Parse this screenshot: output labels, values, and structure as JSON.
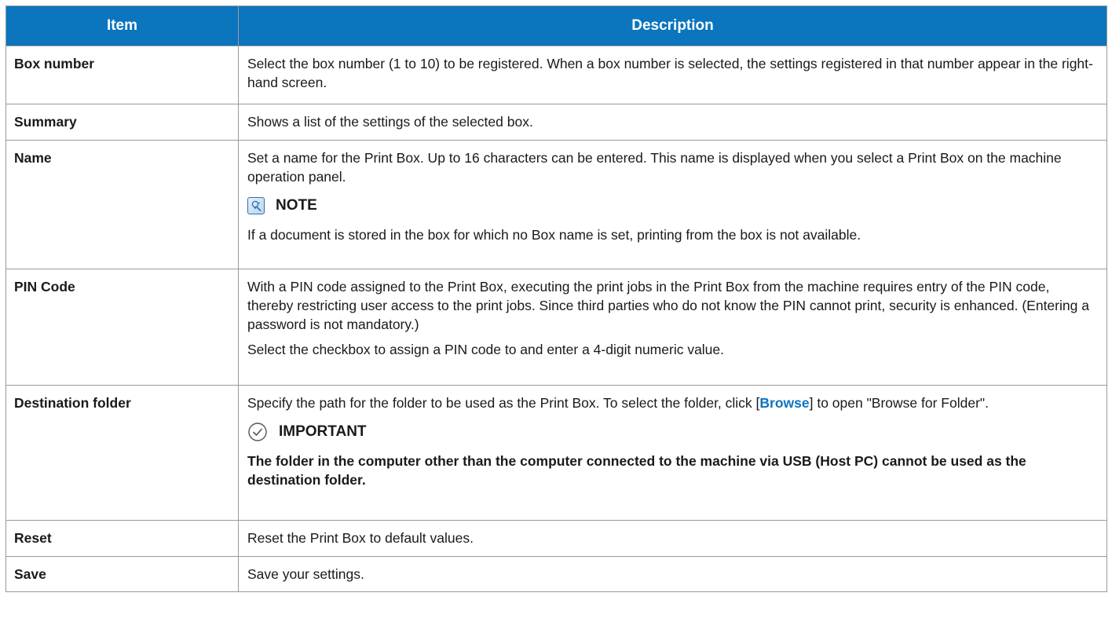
{
  "header": {
    "item": "Item",
    "description": "Description"
  },
  "rows": {
    "box_number": {
      "item": "Box number",
      "desc": "Select the box number (1 to 10) to be registered. When a box number is selected, the settings registered in that number appear in the right-hand screen."
    },
    "summary": {
      "item": "Summary",
      "desc": "Shows a list of the settings of the selected box."
    },
    "name": {
      "item": "Name",
      "desc": "Set a name for the Print Box. Up to 16 characters can be entered. This name is displayed when you select a Print Box on the machine operation panel.",
      "note_title": "NOTE",
      "note_text": "If a document is stored in the box for which no Box name is set, printing from the box is not available."
    },
    "pin_code": {
      "item": "PIN Code",
      "desc1": "With a PIN code assigned to the Print Box, executing the print jobs in the Print Box from the machine requires entry of the PIN code, thereby restricting user access to the print jobs. Since third parties who do not know the PIN cannot print, security is enhanced. (Entering a password is not mandatory.)",
      "desc2": "Select the checkbox to assign a PIN code to and enter a 4-digit numeric value."
    },
    "destination_folder": {
      "item": "Destination folder",
      "desc_before": "Specify the path for the folder to be used as the Print Box. To select the folder, click [",
      "browse": "Browse",
      "desc_after": "] to open \"Browse for Folder\".",
      "important_title": "IMPORTANT",
      "important_text": "The folder in the computer other than the computer connected to the machine via USB (Host PC) cannot be used as the destination folder."
    },
    "reset": {
      "item": "Reset",
      "desc": "Reset the Print Box to default values."
    },
    "save": {
      "item": "Save",
      "desc": "Save your settings."
    }
  },
  "icons": {
    "note": "note-lightbulb-icon",
    "important": "checkmark-circle-icon"
  },
  "colors": {
    "header_bg": "#0b75be",
    "header_text": "#ffffff",
    "link": "#0b75be",
    "border": "#9a9a9a"
  }
}
